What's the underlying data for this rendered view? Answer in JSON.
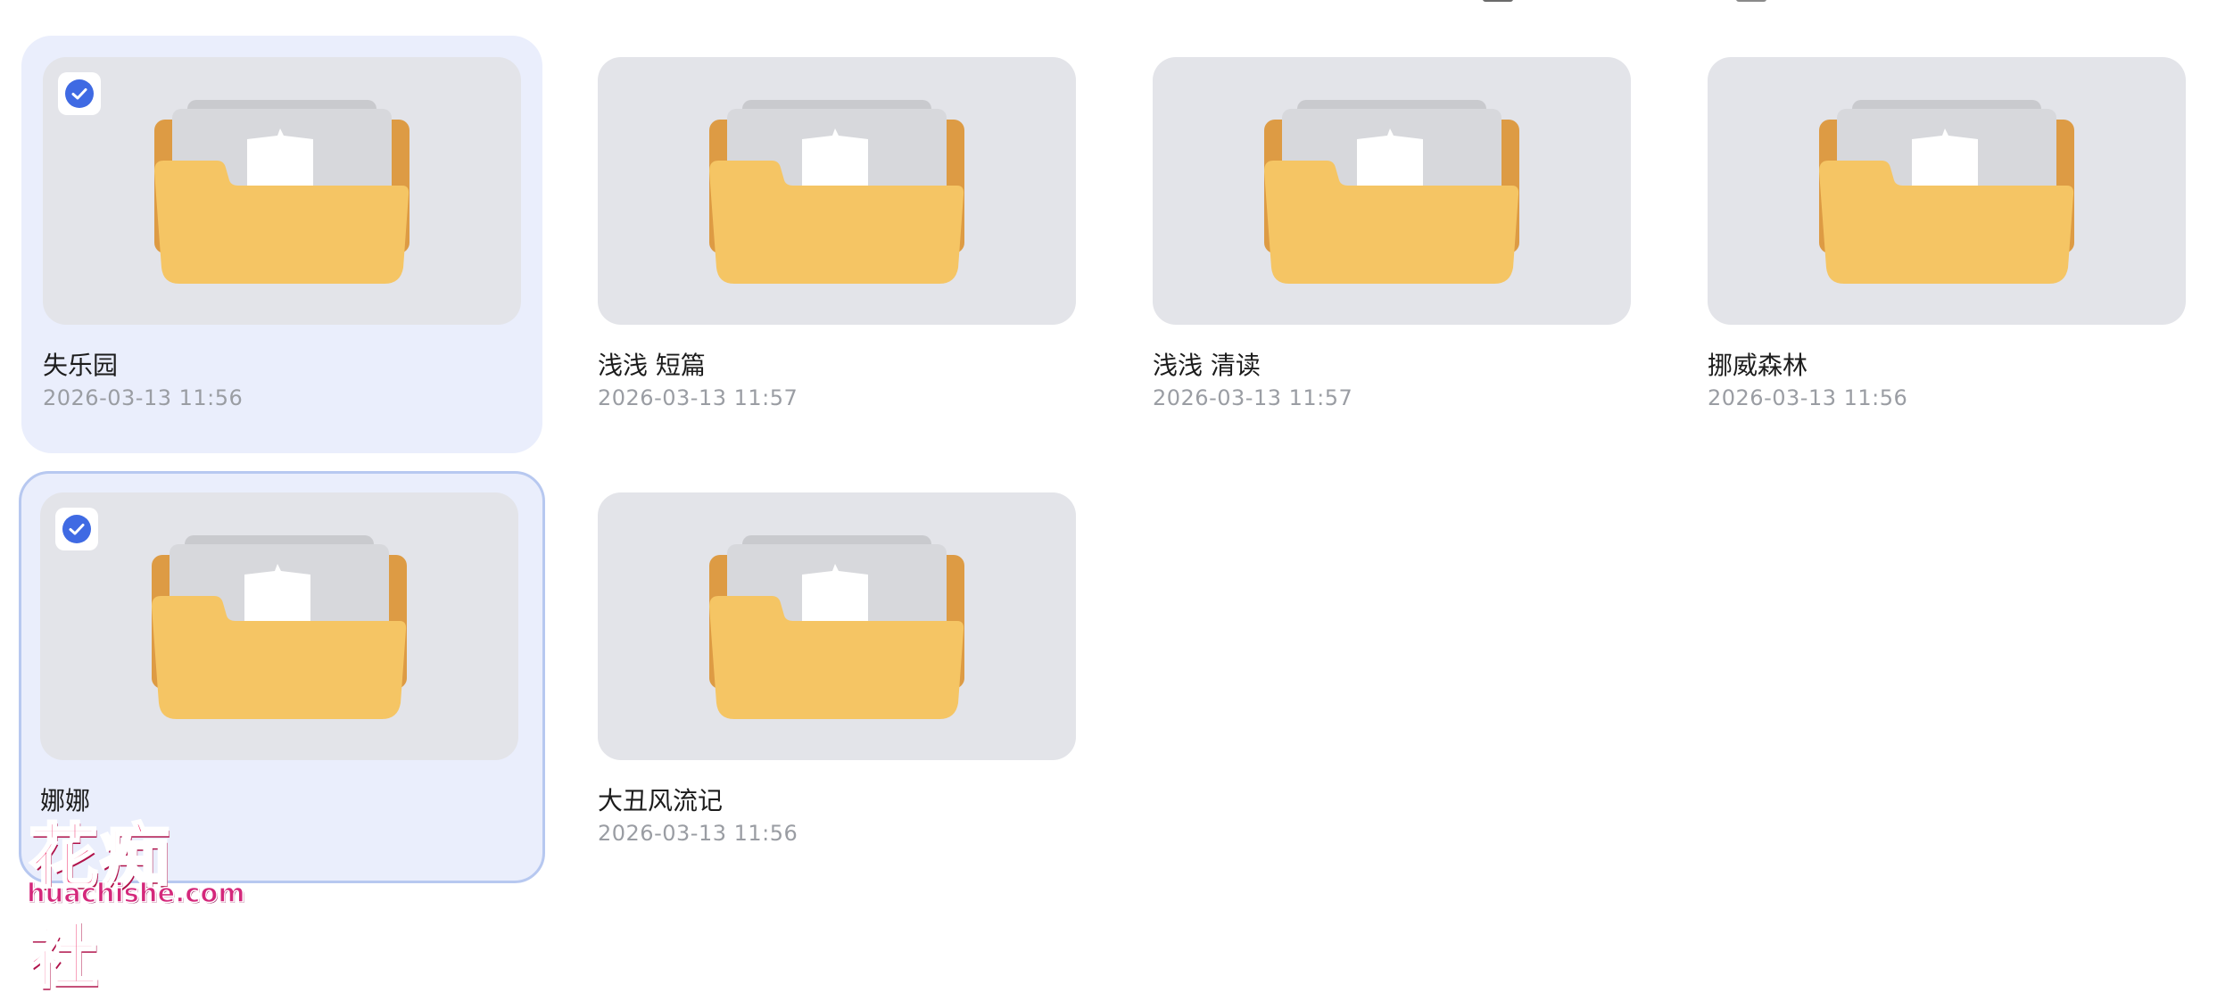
{
  "folders": [
    {
      "title": "失乐园",
      "date": "2026-03-13 11:56",
      "selected": true
    },
    {
      "title": "浅浅 短篇",
      "date": "2026-03-13 11:57",
      "selected": false
    },
    {
      "title": "浅浅 清读",
      "date": "2026-03-13 11:57",
      "selected": false
    },
    {
      "title": "挪威森林",
      "date": "2026-03-13 11:56",
      "selected": false
    },
    {
      "title": "娜娜",
      "date": "",
      "selected": true
    },
    {
      "title": "大丑风流记",
      "date": "2026-03-13 11:56",
      "selected": false
    }
  ],
  "icons": {
    "folder": "folder-icon",
    "check": "check-icon"
  },
  "colors": {
    "accent": "#3f6ae3",
    "selected_bg": "#eaeefc",
    "focus_border": "#b7c8f0",
    "folder_body": "#f5c564",
    "folder_back": "#dd9b44",
    "thumb_bg": "#e3e4e9"
  },
  "watermark": {
    "cn": "花痴社",
    "en": "huachishe.com"
  }
}
